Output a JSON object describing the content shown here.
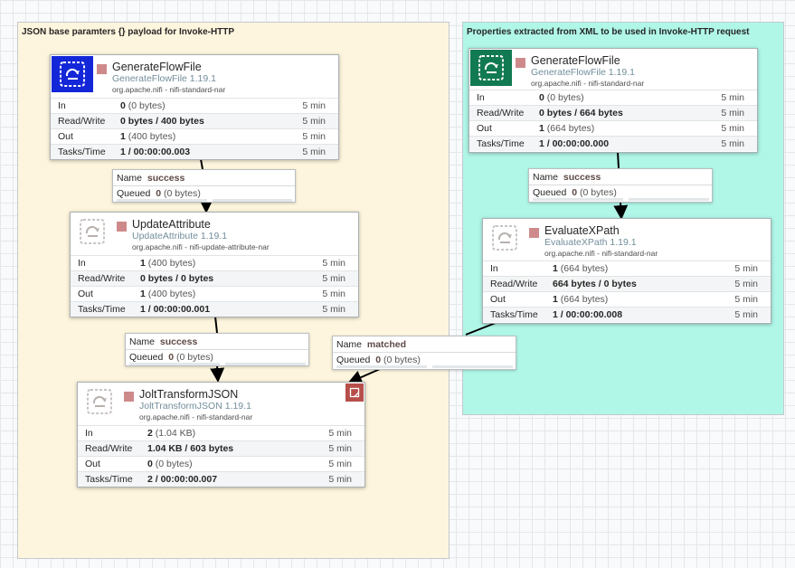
{
  "groups": [
    {
      "title": "JSON base paramters {} payload for Invoke-HTTP",
      "color": "#fdf5dd"
    },
    {
      "title": "Properties extracted from XML to be used in Invoke-HTTP request",
      "color": "#b0f7e8"
    }
  ],
  "stats_labels": {
    "in": "In",
    "rw": "Read/Write",
    "out": "Out",
    "tasks": "Tasks/Time",
    "window": "5 min"
  },
  "conn_labels": {
    "name": "Name",
    "queued": "Queued"
  },
  "processors": {
    "gen1": {
      "name": "GenerateFlowFile",
      "type": "GenerateFlowFile 1.19.1",
      "bundle": "org.apache.nifi - nifi-standard-nar",
      "icon": "generate-flowfile-icon",
      "icon_bg": "#1427d8",
      "in_v": "0",
      "in_s": "(0 bytes)",
      "rw": "0 bytes / 400 bytes",
      "out_v": "1",
      "out_s": "(400 bytes)",
      "tasks": "1 / 00:00:00.003"
    },
    "update": {
      "name": "UpdateAttribute",
      "type": "UpdateAttribute 1.19.1",
      "bundle": "org.apache.nifi - nifi-update-attribute-nar",
      "icon": "processor-icon",
      "in_v": "1",
      "in_s": "(400 bytes)",
      "rw": "0 bytes / 0 bytes",
      "out_v": "1",
      "out_s": "(400 bytes)",
      "tasks": "1 / 00:00:00.001"
    },
    "jolt": {
      "name": "JoltTransformJSON",
      "type": "JoltTransformJSON 1.19.1",
      "bundle": "org.apache.nifi - nifi-standard-nar",
      "icon": "processor-icon",
      "in_v": "2",
      "in_s": "(1.04 KB)",
      "rw": "1.04 KB / 603 bytes",
      "out_v": "0",
      "out_s": "(0 bytes)",
      "tasks": "2 / 00:00:00.007"
    },
    "gen2": {
      "name": "GenerateFlowFile",
      "type": "GenerateFlowFile 1.19.1",
      "bundle": "org.apache.nifi - nifi-standard-nar",
      "icon": "generate-flowfile-icon",
      "icon_bg": "#127a52",
      "in_v": "0",
      "in_s": "(0 bytes)",
      "rw": "0 bytes / 664 bytes",
      "out_v": "1",
      "out_s": "(664 bytes)",
      "tasks": "1 / 00:00:00.000"
    },
    "xpath": {
      "name": "EvaluateXPath",
      "type": "EvaluateXPath 1.19.1",
      "bundle": "org.apache.nifi - nifi-standard-nar",
      "icon": "processor-icon",
      "in_v": "1",
      "in_s": "(664 bytes)",
      "rw": "664 bytes / 0 bytes",
      "out_v": "1",
      "out_s": "(664 bytes)",
      "tasks": "1 / 00:00:00.008"
    }
  },
  "connections": {
    "c1": {
      "name": "success",
      "queued_v": "0",
      "queued_s": "(0 bytes)"
    },
    "c2": {
      "name": "success",
      "queued_v": "0",
      "queued_s": "(0 bytes)"
    },
    "c3": {
      "name": "success",
      "queued_v": "0",
      "queued_s": "(0 bytes)"
    },
    "c4": {
      "name": "matched",
      "queued_v": "0",
      "queued_s": "(0 bytes)"
    }
  },
  "colors": {
    "stopped": "#ce8a8a",
    "note": "#b64f4a"
  }
}
